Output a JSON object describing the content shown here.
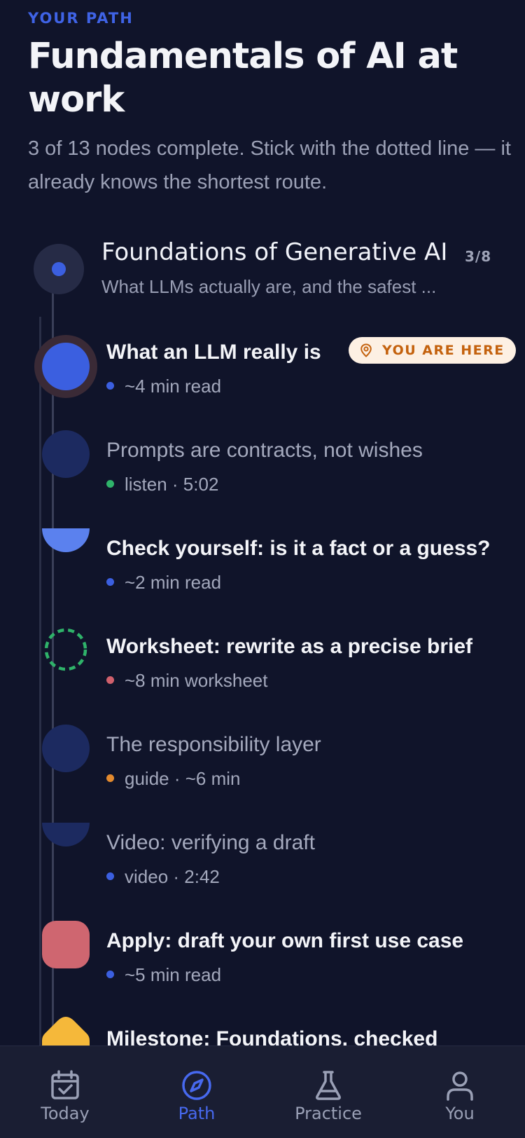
{
  "header": {
    "eyebrow": "YOUR PATH",
    "title": "Fundamentals of AI at work",
    "subtitle": "3 of 13 nodes complete. Stick with the dotted line — it already knows the shortest route."
  },
  "section": {
    "title": "Foundations of Generative AI",
    "count": "3/8",
    "description": "What LLMs actually are, and the safest ..."
  },
  "lessons": [
    {
      "title": "What an LLM really is",
      "meta": "~4 min read",
      "badge": "YOU ARE HERE"
    },
    {
      "title": "Prompts are contracts, not wishes",
      "meta": "listen · 5:02"
    },
    {
      "title": "Check yourself: is it a fact or a guess?",
      "meta": "~2 min read"
    },
    {
      "title": "Worksheet: rewrite as a precise brief",
      "meta": "~8 min worksheet"
    },
    {
      "title": "The responsibility layer",
      "meta": "guide · ~6 min"
    },
    {
      "title": "Video: verifying a draft",
      "meta": "video · 2:42"
    },
    {
      "title": "Apply: draft your own first use case",
      "meta": "~5 min read"
    },
    {
      "title": "Milestone: Foundations, checked",
      "meta": ""
    }
  ],
  "nav": {
    "tabs": [
      {
        "label": "Today",
        "icon": "calendar-check-icon"
      },
      {
        "label": "Path",
        "icon": "compass-icon"
      },
      {
        "label": "Practice",
        "icon": "flask-icon"
      },
      {
        "label": "You",
        "icon": "user-icon"
      }
    ]
  },
  "colors": {
    "background": "#10142a",
    "accent": "#3f63e6",
    "badge_text": "#c4620e",
    "badge_bg": "#fdf0e3",
    "meta_blue": "#3b5fe0",
    "meta_green": "#2fb36a",
    "meta_red": "#d0606c",
    "meta_orange": "#e38a2e",
    "node_coral": "#cf6670",
    "node_yellow": "#f5b83a"
  }
}
